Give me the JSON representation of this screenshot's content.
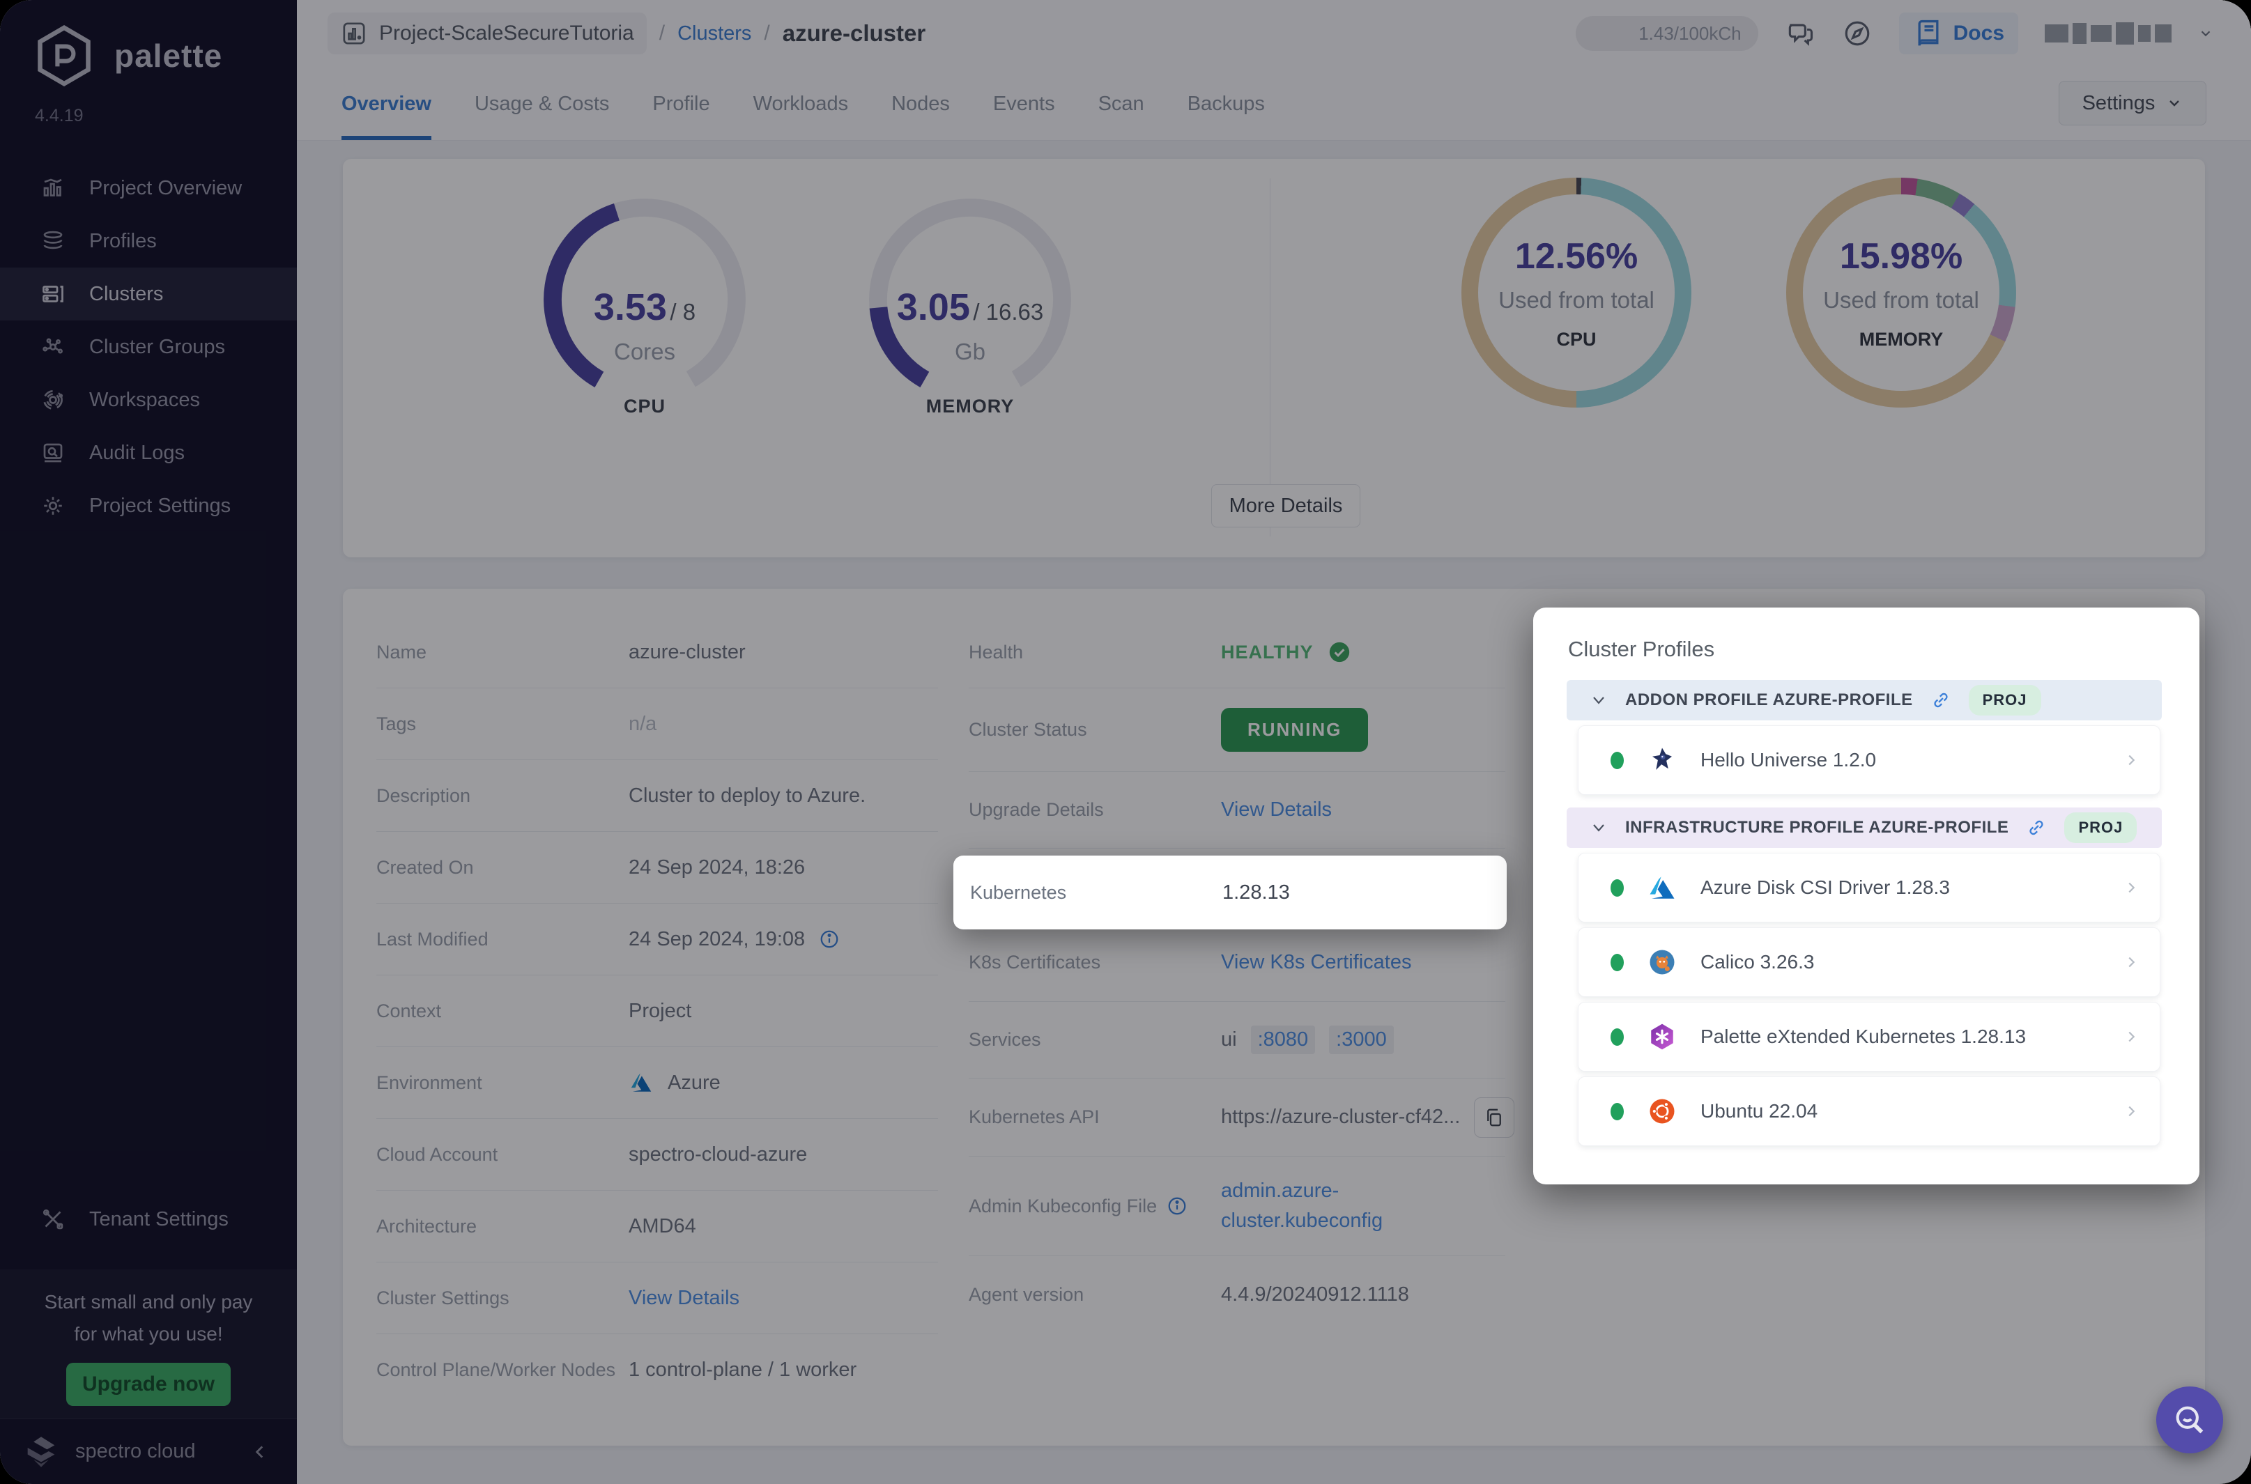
{
  "brand": {
    "name": "palette",
    "version": "4.4.19",
    "footer": "spectro cloud"
  },
  "sidebar": {
    "items": [
      {
        "label": "Project Overview"
      },
      {
        "label": "Profiles"
      },
      {
        "label": "Clusters"
      },
      {
        "label": "Cluster Groups"
      },
      {
        "label": "Workspaces"
      },
      {
        "label": "Audit Logs"
      },
      {
        "label": "Project Settings"
      }
    ],
    "active_item": "Clusters",
    "tenant_settings_label": "Tenant Settings",
    "promo": {
      "line1": "Start small and only pay",
      "line2": "for what you use!",
      "cta": "Upgrade now"
    }
  },
  "header": {
    "breadcrumb": {
      "project": "Project-ScaleSecureTutoria",
      "separator": "/",
      "section": "Clusters",
      "current": "azure-cluster"
    },
    "usage_pill": "1.43/100kCh",
    "docs_label": "Docs"
  },
  "tabs": {
    "labels": [
      "Overview",
      "Usage & Costs",
      "Profile",
      "Workloads",
      "Nodes",
      "Events",
      "Scan",
      "Backups"
    ],
    "active": "Overview"
  },
  "settings_button": {
    "label": "Settings"
  },
  "overview_card": {
    "cpu_gauge": {
      "value": "3.53",
      "divider": "/",
      "total": "8",
      "unit": "Cores",
      "caption": "CPU"
    },
    "memory_gauge": {
      "value": "3.05",
      "divider": "/",
      "total": "16.63",
      "unit": "Gb",
      "caption": "MEMORY"
    },
    "cpu_donut": {
      "pct": "12.56%",
      "sub": "Used from total",
      "caption": "CPU"
    },
    "memory_donut": {
      "pct": "15.98%",
      "sub": "Used from total",
      "caption": "MEMORY"
    },
    "more_details": "More Details"
  },
  "chart_data": [
    {
      "type": "gauge",
      "title": "CPU",
      "value": 3.53,
      "max": 8,
      "unit": "Cores",
      "fill_color": "#4c45a0"
    },
    {
      "type": "gauge",
      "title": "MEMORY",
      "value": 3.05,
      "max": 16.63,
      "unit": "Gb",
      "fill_color": "#4c45a0"
    },
    {
      "type": "donut",
      "title": "CPU",
      "value_pct": 12.56,
      "label": "Used from total",
      "segments": [
        {
          "name": "used",
          "pct": 0.7,
          "color": "#4b4b55"
        },
        {
          "name": "teal",
          "pct": 49.3,
          "color": "#9fdbe2"
        },
        {
          "name": "tan",
          "pct": 50,
          "color": "#e7cda5"
        }
      ]
    },
    {
      "type": "donut",
      "title": "MEMORY",
      "value_pct": 15.98,
      "label": "Used from total",
      "segments": [
        {
          "name": "magenta",
          "pct": 2.3,
          "color": "#c05a9e"
        },
        {
          "name": "green",
          "pct": 6.2,
          "color": "#7fb894"
        },
        {
          "name": "purple",
          "pct": 2.5,
          "color": "#9183cf"
        },
        {
          "name": "teal",
          "pct": 16,
          "color": "#9fdbe2"
        },
        {
          "name": "pink",
          "pct": 5,
          "color": "#cba8ce"
        },
        {
          "name": "tan",
          "pct": 68,
          "color": "#e7cda5"
        }
      ]
    }
  ],
  "details": {
    "left": [
      {
        "label": "Name",
        "value": "azure-cluster"
      },
      {
        "label": "Tags",
        "value": "n/a"
      },
      {
        "label": "Description",
        "value": "Cluster to deploy to Azure."
      },
      {
        "label": "Created On",
        "value": "24 Sep 2024, 18:26"
      },
      {
        "label": "Last Modified",
        "value": "24 Sep 2024, 19:08"
      },
      {
        "label": "Context",
        "value": "Project"
      },
      {
        "label": "Environment",
        "value": "Azure"
      },
      {
        "label": "Cloud Account",
        "value": "spectro-cloud-azure"
      },
      {
        "label": "Architecture",
        "value": "AMD64"
      },
      {
        "label": "Cluster Settings",
        "value": "View Details"
      },
      {
        "label": "Control Plane/Worker Nodes",
        "value": "1 control-plane / 1 worker"
      }
    ],
    "right": {
      "health": {
        "label": "Health",
        "value": "HEALTHY"
      },
      "status": {
        "label": "Cluster Status",
        "value": "RUNNING"
      },
      "upgrade": {
        "label": "Upgrade Details",
        "value": "View Details"
      },
      "kubernetes": {
        "label": "Kubernetes",
        "value": "1.28.13"
      },
      "certs": {
        "label": "K8s Certificates",
        "value": "View K8s Certificates"
      },
      "services": {
        "label": "Services",
        "prefix": "ui",
        "port1": ":8080",
        "port2": ":3000"
      },
      "api": {
        "label": "Kubernetes API",
        "value": "https://azure-cluster-cf42..."
      },
      "kubeconfig": {
        "label": "Admin Kubeconfig File",
        "value": "admin.azure-cluster.kubeconfig"
      },
      "agent": {
        "label": "Agent version",
        "value": "4.4.9/20240912.1118"
      }
    }
  },
  "profiles_panel": {
    "title": "Cluster Profiles",
    "addon": {
      "header": "ADDON PROFILE AZURE-PROFILE",
      "badge": "PROJ",
      "items": [
        {
          "name": "Hello Universe 1.2.0"
        }
      ]
    },
    "infra": {
      "header": "INFRASTRUCTURE PROFILE AZURE-PROFILE",
      "badge": "PROJ",
      "items": [
        {
          "name": "Azure Disk CSI Driver 1.28.3"
        },
        {
          "name": "Calico 3.26.3"
        },
        {
          "name": "Palette eXtended Kubernetes 1.28.13"
        },
        {
          "name": "Ubuntu 22.04"
        }
      ]
    }
  },
  "colors": {
    "accent_blue": "#4f8fe3",
    "indigo": "#4c45a0",
    "green_pill": "#2f9a55",
    "teal": "#9fdbe2",
    "tan": "#e7cda5",
    "fab_purple": "#544cab"
  }
}
